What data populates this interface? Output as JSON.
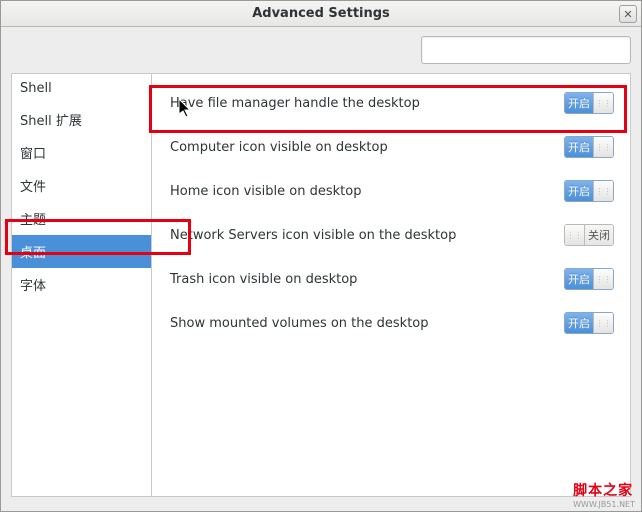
{
  "window": {
    "title": "Advanced Settings"
  },
  "search": {
    "value": ""
  },
  "sidebar": {
    "items": [
      {
        "label": "Shell",
        "selected": false
      },
      {
        "label": "Shell 扩展",
        "selected": false
      },
      {
        "label": "窗口",
        "selected": false
      },
      {
        "label": "文件",
        "selected": false
      },
      {
        "label": "主题",
        "selected": false
      },
      {
        "label": "桌面",
        "selected": true
      },
      {
        "label": "字体",
        "selected": false
      }
    ]
  },
  "settings": [
    {
      "label": "Have file manager handle the desktop",
      "on": true
    },
    {
      "label": "Computer icon visible on desktop",
      "on": true
    },
    {
      "label": "Home icon visible on desktop",
      "on": true
    },
    {
      "label": "Network Servers icon visible on the desktop",
      "on": false
    },
    {
      "label": "Trash icon visible on desktop",
      "on": true
    },
    {
      "label": "Show mounted volumes on the desktop",
      "on": true
    }
  ],
  "switch_labels": {
    "on": "开启",
    "off": "关闭"
  },
  "watermark": {
    "line1": "脚本之家",
    "line2": "WWW.JB51.NET"
  }
}
